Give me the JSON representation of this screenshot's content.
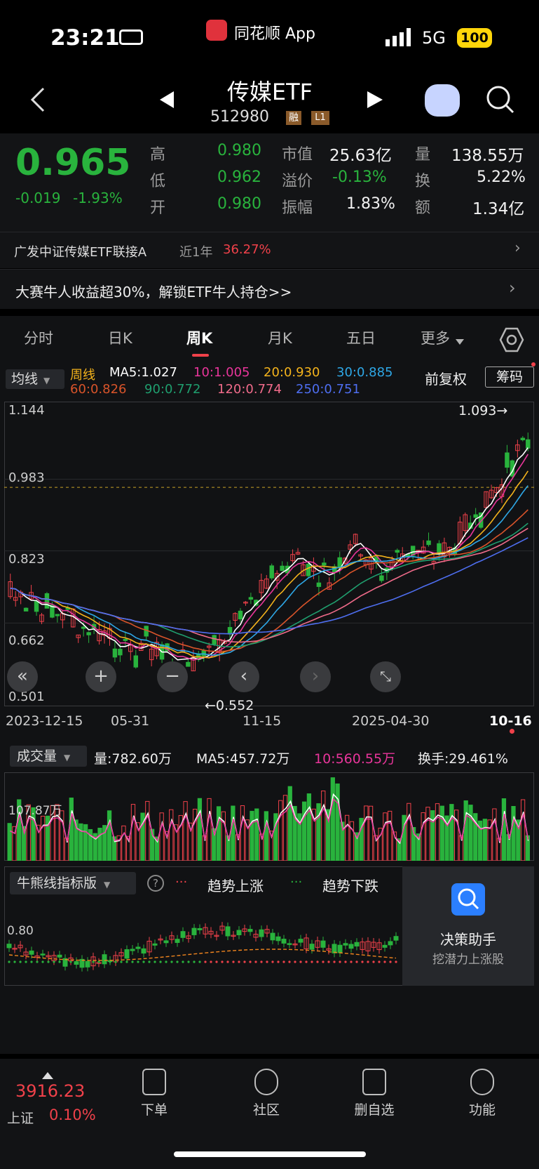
{
  "status": {
    "time": "23:21",
    "app_label": "同花顺 App",
    "network": "5G",
    "battery": "100"
  },
  "header": {
    "title": "传媒ETF",
    "code": "512980",
    "badge_margin": "融",
    "badge_level": "L1"
  },
  "quote": {
    "price": "0.965",
    "change": "-0.019",
    "change_pct": "-1.93%",
    "high_label": "高",
    "high": "0.980",
    "low_label": "低",
    "low": "0.962",
    "open_label": "开",
    "open": "0.980",
    "mktcap_label": "市值",
    "mktcap": "25.63亿",
    "premium_label": "溢价",
    "premium": "-0.13%",
    "amp_label": "振幅",
    "amp": "1.83%",
    "vol_label": "量",
    "vol": "138.55万",
    "turn_label": "换",
    "turn": "5.22%",
    "amount_label": "额",
    "amount": "1.34亿"
  },
  "fund_link": {
    "name": "广发中证传媒ETF联接A",
    "period": "近1年",
    "return": "36.27%"
  },
  "promo": {
    "text": "大赛牛人收益超30%，解锁ETF牛人持仓>>"
  },
  "tabs": [
    "分时",
    "日K",
    "周K",
    "月K",
    "五日",
    "更多"
  ],
  "ma_legend": {
    "selector": "均线",
    "title": "周线",
    "ma5": "MA5:1.027",
    "ma10": "10:1.005",
    "ma20": "20:0.930",
    "ma30": "30:0.885",
    "ma60": "60:0.826",
    "ma90": "90:0.772",
    "ma120": "120:0.774",
    "ma250": "250:0.751",
    "fq": "前复权",
    "chips": "筹码"
  },
  "price_axis": {
    "labels": [
      "1.144",
      "0.983",
      "0.823",
      "0.662",
      "0.501"
    ],
    "high_mark": "1.093→",
    "low_mark": "←0.552"
  },
  "date_axis": [
    "2023-12-15",
    "05-31",
    "11-15",
    "2025-04-30",
    "10-16"
  ],
  "volume": {
    "selector": "成交量",
    "vol": "量:782.60万",
    "ma5": "MA5:457.72万",
    "ma10": "10:560.55万",
    "turnover": "换手:29.461%",
    "axis_label": "107.87万"
  },
  "indicator": {
    "selector": "牛熊线指标版",
    "rise": "趋势上涨",
    "fall": "趋势下跌",
    "axis_label": "0.80",
    "assistant_title": "决策助手",
    "assistant_sub": "挖潜力上涨股"
  },
  "bottom": {
    "index_value": "3916.23",
    "index_name": "上证",
    "index_pct": "0.10%",
    "nav": [
      "下单",
      "社区",
      "删自选",
      "功能"
    ]
  },
  "colors": {
    "up": "#f0414a",
    "down": "#29b33d",
    "ma5": "#ffffff",
    "ma10": "#e8359a",
    "ma20": "#f4b31c",
    "ma30": "#2ea7e6",
    "ma60": "#d9542a",
    "ma90": "#1f9e6e",
    "ma120": "#f06b8a",
    "ma250": "#4e6ef0"
  }
}
